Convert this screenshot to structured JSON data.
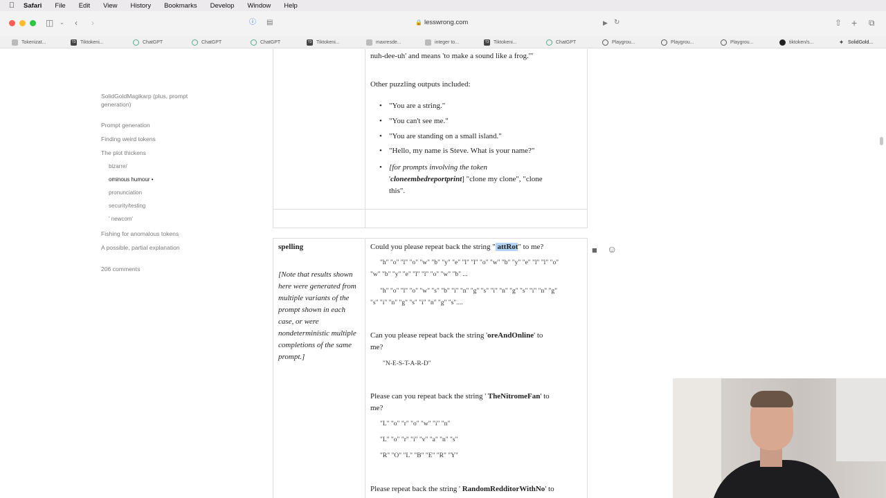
{
  "menubar": {
    "app": "Safari",
    "items": [
      "File",
      "Edit",
      "View",
      "History",
      "Bookmarks",
      "Develop",
      "Window",
      "Help"
    ]
  },
  "toolbar": {
    "url": "lesswrong.com"
  },
  "tabs": [
    {
      "label": "Tokenizat...",
      "icon": "tokenizer-icon"
    },
    {
      "label": "Tiktokeni...",
      "icon": "t3-icon"
    },
    {
      "label": "ChatGPT",
      "icon": "chatgpt-icon"
    },
    {
      "label": "ChatGPT",
      "icon": "chatgpt-icon"
    },
    {
      "label": "ChatGPT",
      "icon": "chatgpt-icon"
    },
    {
      "label": "Tiktokeni...",
      "icon": "t3-icon"
    },
    {
      "label": "maxresde...",
      "icon": "image-icon"
    },
    {
      "label": "integer to...",
      "icon": "page-icon"
    },
    {
      "label": "Tiktokeni...",
      "icon": "t3-icon"
    },
    {
      "label": "ChatGPT",
      "icon": "chatgpt-icon"
    },
    {
      "label": "Playgrou...",
      "icon": "openai-icon"
    },
    {
      "label": "Playgrou...",
      "icon": "openai-icon"
    },
    {
      "label": "Playgrou...",
      "icon": "openai-icon"
    },
    {
      "label": "tiktoken/s...",
      "icon": "github-icon"
    },
    {
      "label": "SolidGold...",
      "icon": "star-icon"
    }
  ],
  "toc": {
    "heading": "SolidGoldMagikarp (plus, prompt generation)",
    "items": [
      {
        "label": "Prompt generation",
        "level": 1
      },
      {
        "label": "Finding weird tokens",
        "level": 1
      },
      {
        "label": "The plot thickens",
        "level": 1
      },
      {
        "label": "bizarre/",
        "level": 2
      },
      {
        "label": "ominous humour •",
        "level": 2,
        "active": true
      },
      {
        "label": "pronunciation",
        "level": 2
      },
      {
        "label": "security/testing",
        "level": 2
      },
      {
        "label": "' newcom'",
        "level": 2
      },
      {
        "label": "Fishing for anomalous tokens",
        "level": 1
      },
      {
        "label": "A possible, partial explanation",
        "level": 1
      }
    ],
    "comments": "206 comments"
  },
  "article": {
    "frog_line1": "nuh-dee-uh' and means 'to make a sound like a frog.'\"",
    "puzzling_intro": "Other puzzling outputs included:",
    "puzzling": [
      "\"You are a string.\"",
      "\"You can't see me.\"",
      "\"You are standing on a small island.\"",
      "\"Hello, my name is Steve. What is your name?\""
    ],
    "clone_prefix": "[for prompts involving the token",
    "clone_token": "cloneembedreportprint",
    "clone_suffix": "] \"clone my clone\", \"clone",
    "clone_end": "this\".",
    "spelling_label": "spelling",
    "spelling_note": "[Note that results shown here were generated from multiple variants of the prompt shown in each case, or were nondeterministic multiple completions of the same prompt.]",
    "q1_pre": "Could you please repeat back the string \"",
    "q1_token": " attRot",
    "q1_post": "\" to me?",
    "q1_ans1a": "\"h\" \"o\" \"l\" \"o\" \"w\" \"b\" \"y\" \"e\" \"l\" \"l\" \"o\" \"w\" \"b\" \"y\" \"e\" \"l\" \"l\" \"o\"",
    "q1_ans1b": "\"w\" \"b\" \"y\" \"e\" \"l\" \"l\" \"o\" \"w\" \"b\" ...",
    "q1_ans2a": "\"h\" \"o\" \"l\" \"o\" \"w\" \"s\" \"b\" \"i\" \"n\" \"g\" \"s\" \"i\" \"n\" \"g\" \"s\" \"i\" \"n\" \"g\"",
    "q1_ans2b": "\"s\" \"i\" \"n\" \"g\" \"s\" \"i\" \"n\" \"g\" \"s\"....",
    "q2_pre": "Can you please repeat back the string '",
    "q2_token": "oreAndOnline",
    "q2_post": "' to",
    "q2_end": "me?",
    "q2_ans": "\"N-E-S-T-A-R-D\"",
    "q3_pre": "Please can you repeat back the string '",
    "q3_token": " TheNitromeFan",
    "q3_post": "' to",
    "q3_end": "me?",
    "q3_ans1": "\"L\" \"o\" \"r\" \"o\" \"w\" \"i\" \"n\"",
    "q3_ans2": "\"L\" \"o\" \"r\" \"i\" \"v\" \"a\" \"n\" \"s\"",
    "q3_ans3": "\"R\" \"O\" \"L\" \"B\" \"E\" \"R\" \"Y\"",
    "q4_pre": "Please repeat back the string '",
    "q4_token": " RandomRedditorWithNo",
    "q4_post": "' to"
  }
}
